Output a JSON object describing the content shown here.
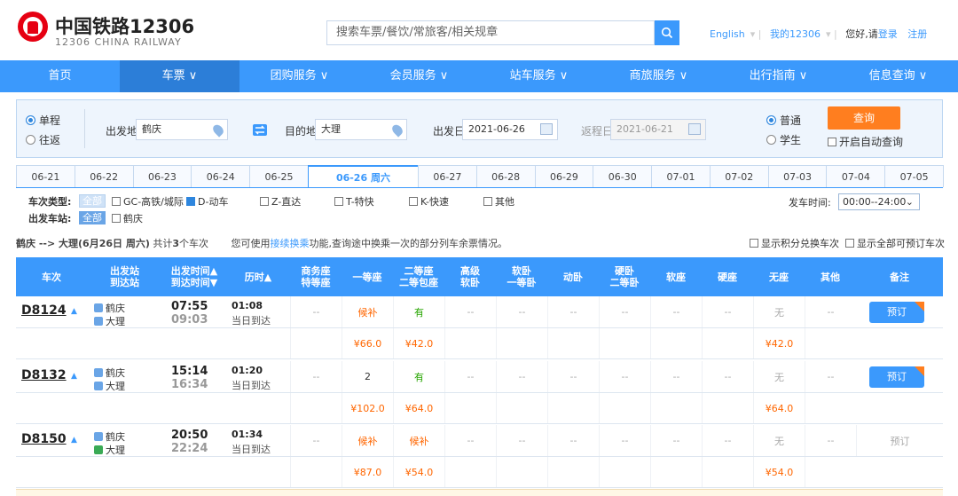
{
  "header": {
    "logo_title": "中国铁路12306",
    "logo_subtitle": "12306 CHINA RAILWAY",
    "search_placeholder": "搜索车票/餐饮/常旅客/相关规章",
    "links": {
      "english": "English",
      "my12306": "我的12306",
      "greeting": "您好,请",
      "login": "登录",
      "register": "注册"
    }
  },
  "nav": [
    "首页",
    "车票 ∨",
    "团购服务 ∨",
    "会员服务 ∨",
    "站车服务 ∨",
    "商旅服务 ∨",
    "出行指南 ∨",
    "信息查询 ∨"
  ],
  "query": {
    "trip_types": [
      "单程",
      "往返"
    ],
    "from_label": "出发地",
    "from_value": "鹤庆",
    "to_label": "目的地",
    "to_value": "大理",
    "depart_label": "出发日",
    "depart_value": "2021-06-26",
    "return_label": "返程日",
    "return_value": "2021-06-21",
    "passenger_types": [
      "普通",
      "学生"
    ],
    "search_button": "查询",
    "auto_query": "开启自动查询"
  },
  "dates": [
    "06-21",
    "06-22",
    "06-23",
    "06-24",
    "06-25",
    "06-26 周六",
    "06-27",
    "06-28",
    "06-29",
    "06-30",
    "07-01",
    "07-02",
    "07-03",
    "07-04",
    "07-05"
  ],
  "filters": {
    "type_label": "车次类型:",
    "all": "全部",
    "types": [
      "GC-高铁/城际",
      "D-动车",
      "Z-直达",
      "T-特快",
      "K-快速",
      "其他"
    ],
    "station_label": "出发车站:",
    "station": "鹤庆",
    "time_label": "发车时间:",
    "time_value": "00:00--24:00"
  },
  "summary": {
    "route": "鹤庆 --> 大理(6月26日 周六)",
    "count_pre": "共计",
    "count": "3",
    "count_post": "个车次",
    "tip_pre": "您可使用",
    "tip_link": "接续换乘",
    "tip_post": "功能,查询途中换乘一次的部分列车余票情况。",
    "opt1": "显示积分兑换车次",
    "opt2": "显示全部可预订车次"
  },
  "table_headers": [
    "车次",
    "出发站\n到达站",
    "出发时间▲\n到达时间▼",
    "历时▲",
    "商务座\n特等座",
    "一等座",
    "二等座\n二等包座",
    "高级\n软卧",
    "软卧\n一等卧",
    "动卧",
    "硬卧\n二等卧",
    "软座",
    "硬座",
    "无座",
    "其他",
    "备注"
  ],
  "trains": [
    {
      "no": "D8124",
      "from": "鹤庆",
      "to": "大理",
      "dep": "07:55",
      "arr": "09:03",
      "dur": "01:08",
      "arrive_day": "当日到达",
      "seats": [
        "--",
        "候补",
        "有",
        "--",
        "--",
        "--",
        "--",
        "--",
        "--",
        "无",
        "--"
      ],
      "prices": {
        "first": "¥66.0",
        "second": "¥42.0",
        "none": "¥42.0"
      },
      "action": "预订",
      "bookable": true,
      "to_badge": "终"
    },
    {
      "no": "D8132",
      "from": "鹤庆",
      "to": "大理",
      "dep": "15:14",
      "arr": "16:34",
      "dur": "01:20",
      "arrive_day": "当日到达",
      "seats": [
        "--",
        "2",
        "有",
        "--",
        "--",
        "--",
        "--",
        "--",
        "--",
        "无",
        "--"
      ],
      "prices": {
        "first": "¥102.0",
        "second": "¥64.0",
        "none": "¥64.0"
      },
      "action": "预订",
      "bookable": true,
      "to_badge": "终"
    },
    {
      "no": "D8150",
      "from": "鹤庆",
      "to": "大理",
      "dep": "20:50",
      "arr": "22:24",
      "dur": "01:34",
      "arrive_day": "当日到达",
      "seats": [
        "--",
        "候补",
        "候补",
        "--",
        "--",
        "--",
        "--",
        "--",
        "--",
        "无",
        "--"
      ],
      "prices": {
        "first": "¥87.0",
        "second": "¥54.0",
        "none": "¥54.0"
      },
      "action": "预订",
      "bookable": false,
      "to_badge": "过"
    }
  ],
  "colors": {
    "primary": "#3b99fc",
    "accent": "#ff7e1f",
    "price": "#f60",
    "available": "#26a500"
  }
}
